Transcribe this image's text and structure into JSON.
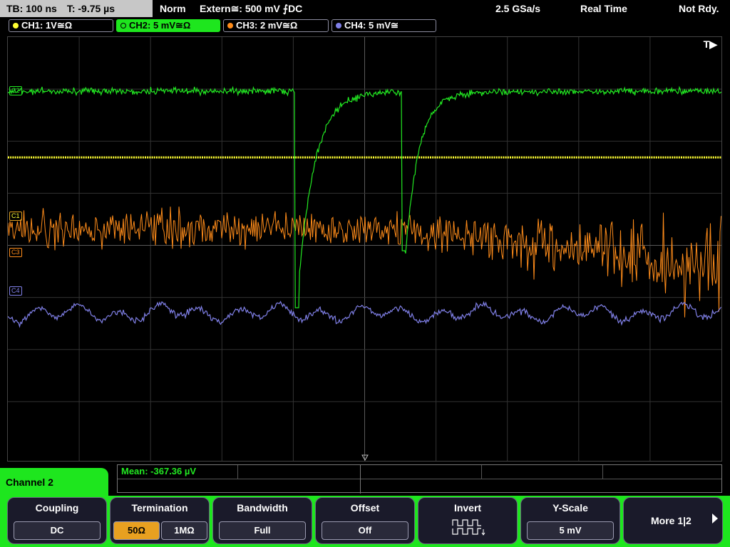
{
  "status_bar": {
    "timebase": "TB: 100 ns",
    "trigger_time": "T: -9.75 µs",
    "trigger_mode": "Norm",
    "trigger_source": "Extern≅: 500 mV ⨍DC",
    "sample_rate": "2.5 GSa/s",
    "acq_mode": "Real Time",
    "state": "Not Rdy."
  },
  "channels": [
    {
      "label": "CH1: 1V≅Ω",
      "color": "#ffff33",
      "active": false
    },
    {
      "label": "CH2: 5 mV≅Ω",
      "color": "#22e822",
      "active": true
    },
    {
      "label": "CH3: 2 mV≅Ω",
      "color": "#ff8c1a",
      "active": false
    },
    {
      "label": "CH4: 5 mV≅",
      "color": "#8080e8",
      "active": false
    }
  ],
  "plot": {
    "trigger_marker": "T▶",
    "markers": {
      "c2": "C2",
      "c1": "C1",
      "c3": "C3",
      "c4": "C4"
    }
  },
  "measurement": {
    "mean": "Mean: -367.36 µV"
  },
  "channel_menu": {
    "title": "Channel 2"
  },
  "softkeys": {
    "coupling": {
      "title": "Coupling",
      "value": "DC"
    },
    "termination": {
      "title": "Termination",
      "opt1": "50Ω",
      "opt2": "1MΩ",
      "selected": "50Ω"
    },
    "bandwidth": {
      "title": "Bandwidth",
      "value": "Full"
    },
    "offset": {
      "title": "Offset",
      "value": "Off"
    },
    "invert": {
      "title": "Invert"
    },
    "yscale": {
      "title": "Y-Scale",
      "value": "5 mV"
    },
    "more": {
      "label": "More 1|2"
    }
  }
}
